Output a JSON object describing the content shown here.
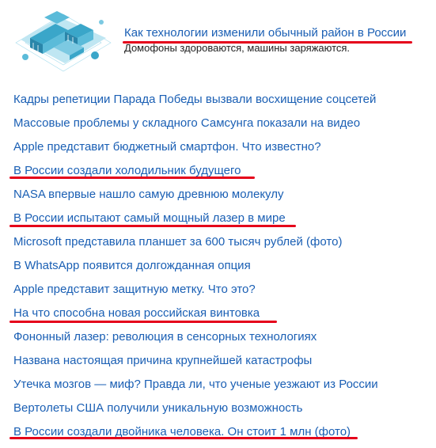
{
  "featured": {
    "image_icon": "isometric-city-district-illustration",
    "title": "Как технологии изменили обычный район в России",
    "subtitle": "Домофоны здороваются, машины заряжаются."
  },
  "news": [
    {
      "title": "Кадры репетиции Парада Победы вызвали восхищение соцсетей"
    },
    {
      "title": "Массовые проблемы у складного Самсунга показали на видео"
    },
    {
      "title": "Apple представит бюджетный смартфон. Что известно?"
    },
    {
      "title": "В России создали холодильник будущего"
    },
    {
      "title": "NASA впервые нашло самую древнюю молекулу"
    },
    {
      "title": "В России испытают самый мощный лазер в мире"
    },
    {
      "title": "Microsoft представила планшет за 600 тысяч рублей (фото)"
    },
    {
      "title": "В WhatsApp появится долгожданная опция"
    },
    {
      "title": "Apple представит защитную метку. Что это?"
    },
    {
      "title": "На что способна новая российская винтовка"
    },
    {
      "title": "Фононный лазер: революция в сенсорных технологиях"
    },
    {
      "title": "Названа настоящая причина крупнейшей катастрофы"
    },
    {
      "title": "Утечка мозгов — миф? Правда ли, что ученые уезжают из России"
    },
    {
      "title": "Вертолеты США получили уникальную возможность"
    },
    {
      "title": "В России создали двойника человека. Он стоит 1 млн (фото)"
    }
  ],
  "colors": {
    "link": "#1a5fb4",
    "text": "#222222",
    "highlight_underline": "#e5001a",
    "thumb_main": "#3aa6c9"
  }
}
